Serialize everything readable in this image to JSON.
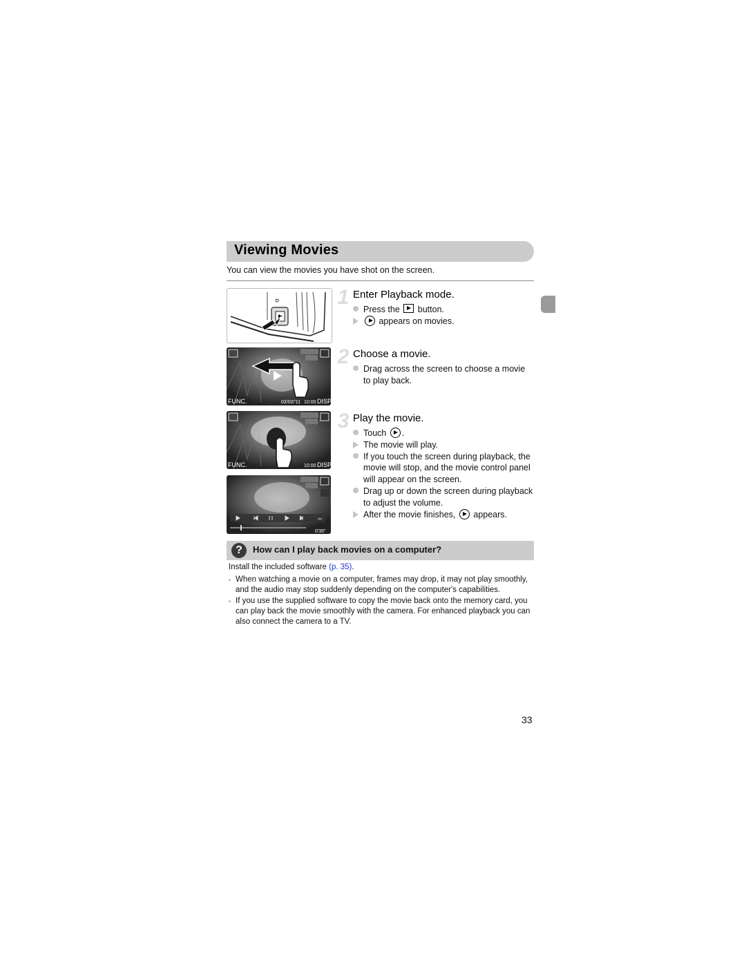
{
  "section": {
    "title": "Viewing Movies",
    "intro": "You can view the movies you have shot on the screen."
  },
  "steps": [
    {
      "number": "1",
      "title": "Enter Playback mode.",
      "bullets": [
        {
          "type": "action",
          "before": "Press the",
          "icon": "playback-button-icon",
          "after": "button."
        },
        {
          "type": "result",
          "before": "",
          "icon": "play-circle-icon",
          "after": "appears on movies."
        }
      ]
    },
    {
      "number": "2",
      "title": "Choose a movie.",
      "bullets": [
        {
          "type": "action",
          "text": "Drag across the screen to choose a movie to play back."
        }
      ]
    },
    {
      "number": "3",
      "title": "Play the movie.",
      "bullets": [
        {
          "type": "action",
          "before": "Touch",
          "icon": "play-circle-icon",
          "after": "."
        },
        {
          "type": "result",
          "text": "The movie will play."
        },
        {
          "type": "action",
          "text": "If you touch the screen during playback, the movie will stop, and the movie control panel will appear on the screen."
        },
        {
          "type": "action",
          "text": "Drag up or down the screen during playback to adjust the volume."
        },
        {
          "type": "result",
          "before": "After the movie finishes,",
          "icon": "play-circle-icon",
          "after": "appears."
        }
      ]
    }
  ],
  "screens": {
    "file_number": "100-0024",
    "size_badge": "1280x720 / 15",
    "date": "02/02/'11",
    "time": "10:00",
    "func_label": "FUNC.",
    "disp_label": "DISP",
    "elapsed": "0'35\""
  },
  "faq": {
    "title": "How can I play back movies on a computer?",
    "install_text": "Install the included software",
    "install_link": "(p. 35)",
    "install_end": ".",
    "notes": [
      "When watching a movie on a computer, frames may drop, it may not play smoothly, and the audio may stop suddenly depending on the computer's capabilities.",
      "If you use the supplied software to copy the movie back onto the memory card, you can play back the movie smoothly with the camera. For enhanced playback you can also connect the camera to a TV."
    ]
  },
  "page_number": "33"
}
